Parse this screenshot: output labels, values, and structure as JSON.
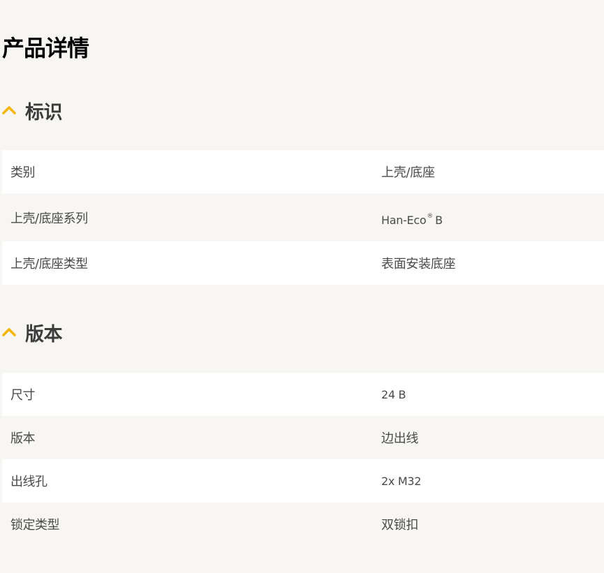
{
  "page": {
    "title": "产品详情"
  },
  "colors": {
    "accent": "#f4b400",
    "background": "#f7f6f2",
    "row_white": "#ffffff"
  },
  "sections": [
    {
      "title": "标识",
      "icon": "chevron-up-icon",
      "rows": [
        {
          "label": "类别",
          "value": "上壳/底座"
        },
        {
          "label": "上壳/底座系列",
          "value": "Han-Eco",
          "value_sup": "®",
          "value_suffix": "B"
        },
        {
          "label": "上壳/底座类型",
          "value": "表面安装底座"
        }
      ]
    },
    {
      "title": "版本",
      "icon": "chevron-up-icon",
      "rows": [
        {
          "label": "尺寸",
          "value": "24 B"
        },
        {
          "label": "版本",
          "value": "边出线"
        },
        {
          "label": "出线孔",
          "value": "2x M32"
        },
        {
          "label": "锁定类型",
          "value": "双锁扣"
        }
      ]
    }
  ]
}
